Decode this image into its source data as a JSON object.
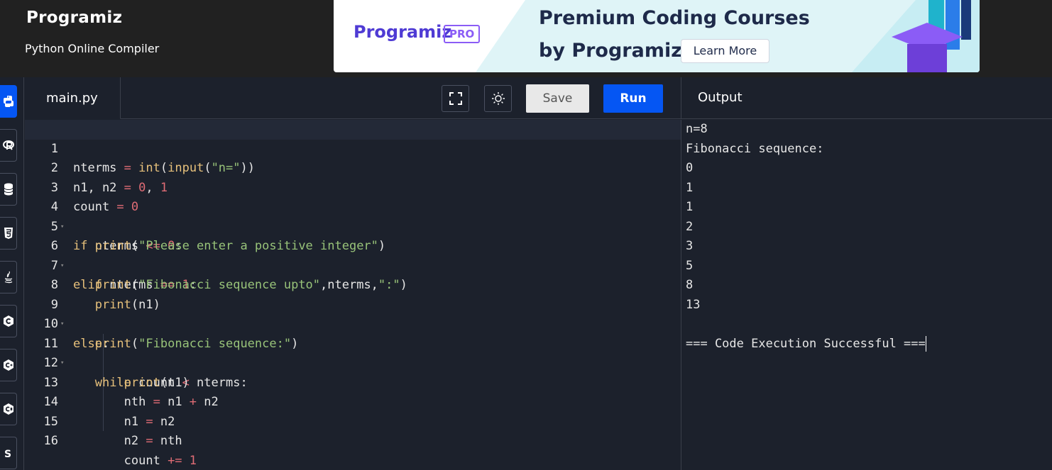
{
  "header": {
    "logo": "Programiz",
    "subtitle": "Python Online Compiler"
  },
  "banner": {
    "logo": "Programiz",
    "badge": "PRO",
    "title_line1": "Premium Coding Courses",
    "title_line2": "by Programiz",
    "button": "Learn More"
  },
  "sidebar": {
    "languages": [
      {
        "icon": "python-icon",
        "active": true
      },
      {
        "icon": "r-icon",
        "active": false
      },
      {
        "icon": "sql-icon",
        "active": false
      },
      {
        "icon": "html-icon",
        "active": false
      },
      {
        "icon": "java-icon",
        "active": false
      },
      {
        "icon": "c-icon",
        "active": false
      },
      {
        "icon": "cpp-icon",
        "active": false
      },
      {
        "icon": "csharp-icon",
        "active": false
      },
      {
        "icon": "javascript-icon",
        "active": false
      }
    ]
  },
  "editor": {
    "tab": "main.py",
    "save_label": "Save",
    "run_label": "Run",
    "line_numbers": [
      "1",
      "2",
      "3",
      "4",
      "5",
      "6",
      "7",
      "8",
      "9",
      "10",
      "11",
      "12",
      "13",
      "14",
      "15",
      "16"
    ]
  },
  "output": {
    "title": "Output",
    "lines": [
      "n=8",
      "Fibonacci sequence:",
      "0",
      "1",
      "1",
      "2",
      "3",
      "5",
      "8",
      "13",
      "",
      "=== Code Execution Successful ==="
    ]
  },
  "colors": {
    "accent": "#0556f3",
    "background": "#1c212c",
    "header": "#212121"
  }
}
